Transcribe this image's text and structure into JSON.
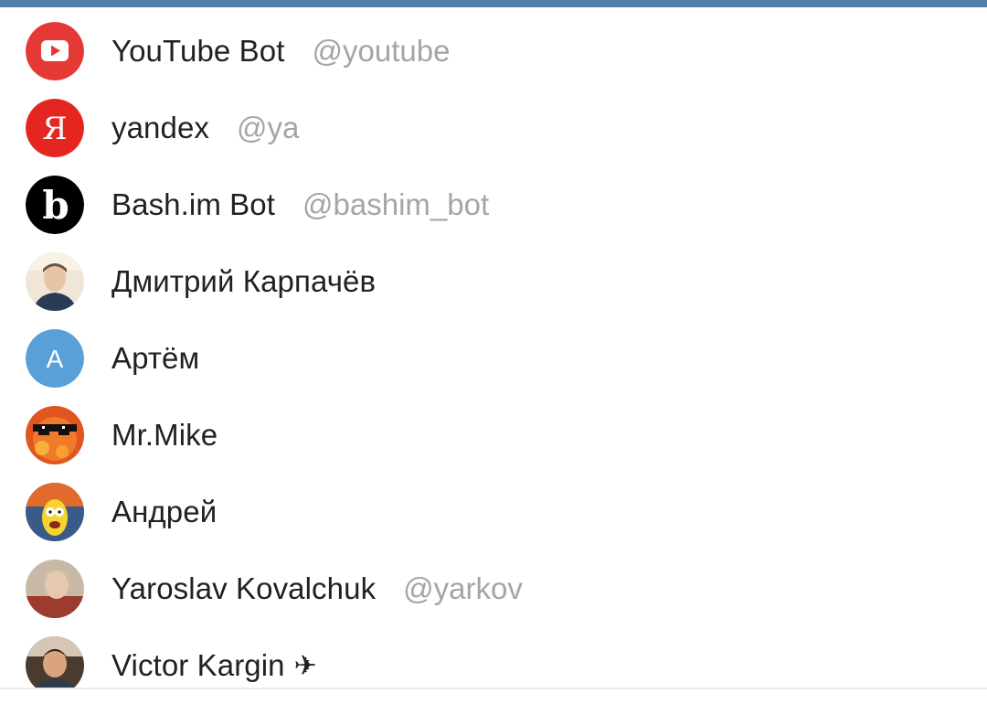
{
  "theme": {
    "header_bar_color": "#5380a8"
  },
  "contacts": [
    {
      "name": "YouTube Bot",
      "username": "@youtube",
      "avatar": "youtube-logo",
      "avatar_color": "#e53935"
    },
    {
      "name": "yandex",
      "username": "@ya",
      "avatar": "yandex-logo",
      "avatar_color": "#e52620",
      "avatar_letter": "Я"
    },
    {
      "name": "Bash.im Bot",
      "username": "@bashim_bot",
      "avatar": "bashim-logo",
      "avatar_color": "#000000",
      "avatar_letter": "b"
    },
    {
      "name": "Дмитрий Карпачёв",
      "username": "",
      "avatar": "user-photo"
    },
    {
      "name": "Артём",
      "username": "",
      "avatar": "letter-avatar",
      "avatar_color": "#5aa0d8",
      "avatar_letter": "А"
    },
    {
      "name": "Mr.Mike",
      "username": "",
      "avatar": "user-photo"
    },
    {
      "name": "Андрей",
      "username": "",
      "avatar": "user-photo"
    },
    {
      "name": "Yaroslav Kovalchuk",
      "username": "@yarkov",
      "avatar": "user-photo"
    },
    {
      "name": "Victor Kargin",
      "username": "",
      "avatar": "user-photo",
      "suffix_icon": "✈"
    }
  ]
}
